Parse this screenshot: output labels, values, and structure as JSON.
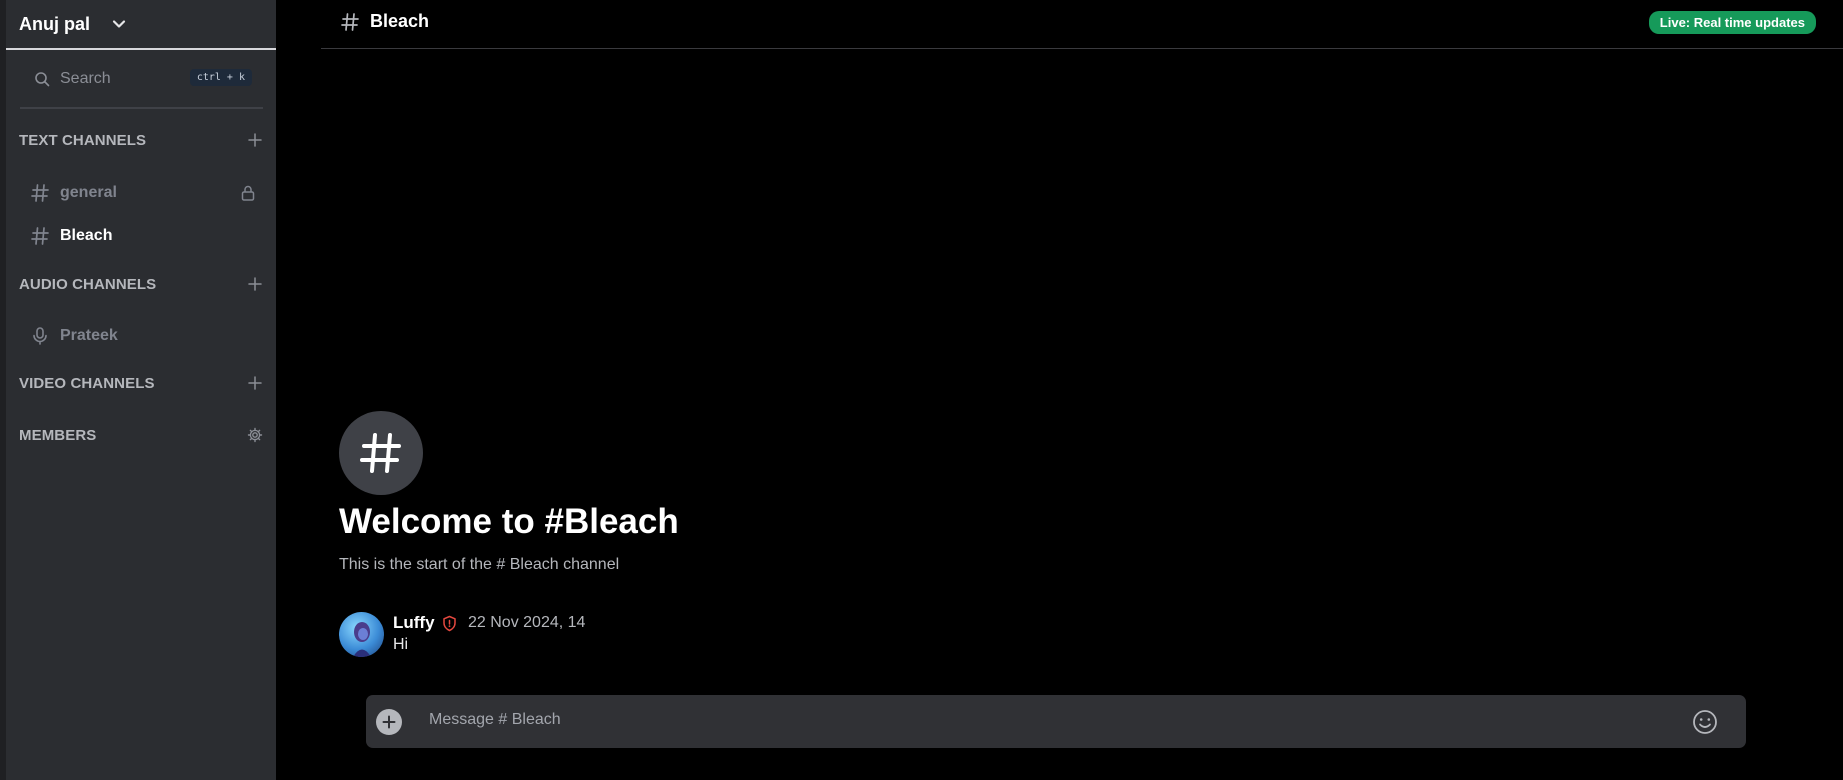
{
  "server": {
    "name": "Anuj pal"
  },
  "search": {
    "placeholder": "Search",
    "shortcut": "ctrl + k"
  },
  "sections": {
    "text": {
      "label": "TEXT CHANNELS"
    },
    "audio": {
      "label": "AUDIO CHANNELS"
    },
    "video": {
      "label": "VIDEO CHANNELS"
    },
    "members": {
      "label": "MEMBERS"
    }
  },
  "channels": {
    "text": [
      {
        "label": "general",
        "locked": true
      },
      {
        "label": "Bleach",
        "active": true
      }
    ],
    "audio": [
      {
        "label": "Prateek"
      }
    ]
  },
  "header": {
    "title": "Bleach",
    "live_badge": "Live: Real time updates"
  },
  "welcome": {
    "title": "Welcome to #Bleach",
    "subtitle": "This is the start of the # Bleach channel"
  },
  "messages": [
    {
      "author": "Luffy",
      "timestamp": "22 Nov 2024, 14",
      "text": "Hi",
      "role_icon": "shield-icon"
    }
  ],
  "composer": {
    "placeholder": "Message # Bleach"
  },
  "colors": {
    "sidebar_bg": "#2b2d31",
    "main_bg": "#000000",
    "live_badge": "#169a5a",
    "moderator_shield": "#e5483f"
  }
}
